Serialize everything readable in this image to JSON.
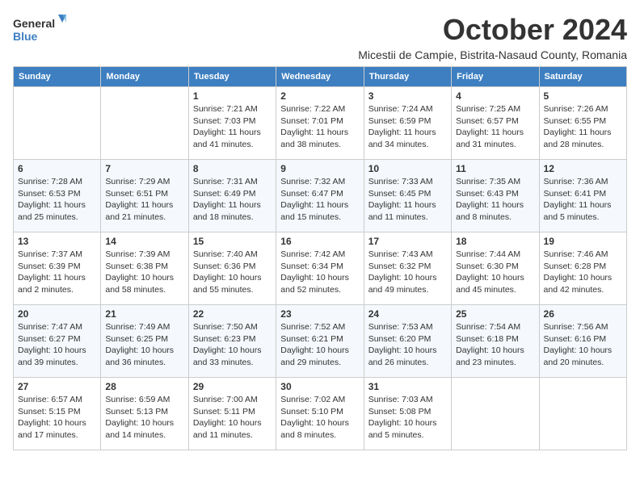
{
  "logo": {
    "line1": "General",
    "line2": "Blue"
  },
  "title": "October 2024",
  "subtitle": "Micestii de Campie, Bistrita-Nasaud County, Romania",
  "weekdays": [
    "Sunday",
    "Monday",
    "Tuesday",
    "Wednesday",
    "Thursday",
    "Friday",
    "Saturday"
  ],
  "weeks": [
    [
      {
        "day": "",
        "info": ""
      },
      {
        "day": "",
        "info": ""
      },
      {
        "day": "1",
        "info": "Sunrise: 7:21 AM\nSunset: 7:03 PM\nDaylight: 11 hours and 41 minutes."
      },
      {
        "day": "2",
        "info": "Sunrise: 7:22 AM\nSunset: 7:01 PM\nDaylight: 11 hours and 38 minutes."
      },
      {
        "day": "3",
        "info": "Sunrise: 7:24 AM\nSunset: 6:59 PM\nDaylight: 11 hours and 34 minutes."
      },
      {
        "day": "4",
        "info": "Sunrise: 7:25 AM\nSunset: 6:57 PM\nDaylight: 11 hours and 31 minutes."
      },
      {
        "day": "5",
        "info": "Sunrise: 7:26 AM\nSunset: 6:55 PM\nDaylight: 11 hours and 28 minutes."
      }
    ],
    [
      {
        "day": "6",
        "info": "Sunrise: 7:28 AM\nSunset: 6:53 PM\nDaylight: 11 hours and 25 minutes."
      },
      {
        "day": "7",
        "info": "Sunrise: 7:29 AM\nSunset: 6:51 PM\nDaylight: 11 hours and 21 minutes."
      },
      {
        "day": "8",
        "info": "Sunrise: 7:31 AM\nSunset: 6:49 PM\nDaylight: 11 hours and 18 minutes."
      },
      {
        "day": "9",
        "info": "Sunrise: 7:32 AM\nSunset: 6:47 PM\nDaylight: 11 hours and 15 minutes."
      },
      {
        "day": "10",
        "info": "Sunrise: 7:33 AM\nSunset: 6:45 PM\nDaylight: 11 hours and 11 minutes."
      },
      {
        "day": "11",
        "info": "Sunrise: 7:35 AM\nSunset: 6:43 PM\nDaylight: 11 hours and 8 minutes."
      },
      {
        "day": "12",
        "info": "Sunrise: 7:36 AM\nSunset: 6:41 PM\nDaylight: 11 hours and 5 minutes."
      }
    ],
    [
      {
        "day": "13",
        "info": "Sunrise: 7:37 AM\nSunset: 6:39 PM\nDaylight: 11 hours and 2 minutes."
      },
      {
        "day": "14",
        "info": "Sunrise: 7:39 AM\nSunset: 6:38 PM\nDaylight: 10 hours and 58 minutes."
      },
      {
        "day": "15",
        "info": "Sunrise: 7:40 AM\nSunset: 6:36 PM\nDaylight: 10 hours and 55 minutes."
      },
      {
        "day": "16",
        "info": "Sunrise: 7:42 AM\nSunset: 6:34 PM\nDaylight: 10 hours and 52 minutes."
      },
      {
        "day": "17",
        "info": "Sunrise: 7:43 AM\nSunset: 6:32 PM\nDaylight: 10 hours and 49 minutes."
      },
      {
        "day": "18",
        "info": "Sunrise: 7:44 AM\nSunset: 6:30 PM\nDaylight: 10 hours and 45 minutes."
      },
      {
        "day": "19",
        "info": "Sunrise: 7:46 AM\nSunset: 6:28 PM\nDaylight: 10 hours and 42 minutes."
      }
    ],
    [
      {
        "day": "20",
        "info": "Sunrise: 7:47 AM\nSunset: 6:27 PM\nDaylight: 10 hours and 39 minutes."
      },
      {
        "day": "21",
        "info": "Sunrise: 7:49 AM\nSunset: 6:25 PM\nDaylight: 10 hours and 36 minutes."
      },
      {
        "day": "22",
        "info": "Sunrise: 7:50 AM\nSunset: 6:23 PM\nDaylight: 10 hours and 33 minutes."
      },
      {
        "day": "23",
        "info": "Sunrise: 7:52 AM\nSunset: 6:21 PM\nDaylight: 10 hours and 29 minutes."
      },
      {
        "day": "24",
        "info": "Sunrise: 7:53 AM\nSunset: 6:20 PM\nDaylight: 10 hours and 26 minutes."
      },
      {
        "day": "25",
        "info": "Sunrise: 7:54 AM\nSunset: 6:18 PM\nDaylight: 10 hours and 23 minutes."
      },
      {
        "day": "26",
        "info": "Sunrise: 7:56 AM\nSunset: 6:16 PM\nDaylight: 10 hours and 20 minutes."
      }
    ],
    [
      {
        "day": "27",
        "info": "Sunrise: 6:57 AM\nSunset: 5:15 PM\nDaylight: 10 hours and 17 minutes."
      },
      {
        "day": "28",
        "info": "Sunrise: 6:59 AM\nSunset: 5:13 PM\nDaylight: 10 hours and 14 minutes."
      },
      {
        "day": "29",
        "info": "Sunrise: 7:00 AM\nSunset: 5:11 PM\nDaylight: 10 hours and 11 minutes."
      },
      {
        "day": "30",
        "info": "Sunrise: 7:02 AM\nSunset: 5:10 PM\nDaylight: 10 hours and 8 minutes."
      },
      {
        "day": "31",
        "info": "Sunrise: 7:03 AM\nSunset: 5:08 PM\nDaylight: 10 hours and 5 minutes."
      },
      {
        "day": "",
        "info": ""
      },
      {
        "day": "",
        "info": ""
      }
    ]
  ]
}
